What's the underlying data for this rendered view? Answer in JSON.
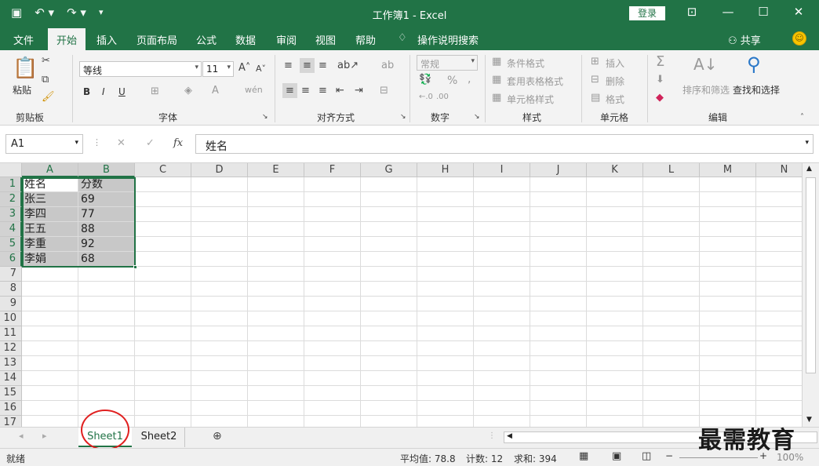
{
  "titlebar": {
    "title": "工作簿1 - Excel",
    "login": "登录",
    "qat_icons": [
      "save-icon",
      "undo-icon",
      "redo-icon",
      "customize-qat-icon"
    ]
  },
  "tabs": {
    "items": [
      "文件",
      "开始",
      "插入",
      "页面布局",
      "公式",
      "数据",
      "审阅",
      "视图",
      "帮助"
    ],
    "active": "开始",
    "tell_me": "操作说明搜索",
    "share": "共享"
  },
  "ribbon": {
    "clipboard": {
      "label": "剪贴板",
      "paste": "粘贴"
    },
    "font": {
      "label": "字体",
      "name": "等线",
      "size": "11",
      "bold": "B",
      "italic": "I",
      "underline": "U"
    },
    "alignment": {
      "label": "对齐方式"
    },
    "number": {
      "label": "数字",
      "format": "常规",
      "percent": "%",
      "comma": ","
    },
    "styles": {
      "label": "样式",
      "conditional": "条件格式",
      "table": "套用表格格式",
      "cell": "单元格样式"
    },
    "cells": {
      "label": "单元格",
      "insert": "插入",
      "delete": "删除",
      "format": "格式"
    },
    "editing": {
      "label": "编辑",
      "sort": "排序和筛选",
      "find": "查找和选择"
    }
  },
  "formula_bar": {
    "name_box": "A1",
    "fx": "fx",
    "content": "姓名"
  },
  "grid": {
    "columns": [
      "A",
      "B",
      "C",
      "D",
      "E",
      "F",
      "G",
      "H",
      "I",
      "J",
      "K",
      "L",
      "M",
      "N"
    ],
    "rows": [
      "1",
      "2",
      "3",
      "4",
      "5",
      "6",
      "7",
      "8",
      "9",
      "10",
      "11",
      "12",
      "13",
      "14",
      "15",
      "16",
      "17"
    ],
    "cells": [
      [
        "姓名",
        "分数"
      ],
      [
        "张三",
        "69"
      ],
      [
        "李四",
        "77"
      ],
      [
        "王五",
        "88"
      ],
      [
        "李重",
        "92"
      ],
      [
        "李娟",
        "68"
      ]
    ],
    "selection_color": "#217346"
  },
  "sheets": {
    "items": [
      "Sheet1",
      "Sheet2"
    ],
    "active": "Sheet1"
  },
  "status": {
    "ready": "就绪",
    "average": "平均值: 78.8",
    "count": "计数: 12",
    "sum": "求和: 394",
    "zoom": "100%"
  },
  "watermark": "最需教育",
  "colors": {
    "excel_green": "#217346",
    "highlight": "#c8c8c8",
    "annotation_red": "#e02020"
  }
}
